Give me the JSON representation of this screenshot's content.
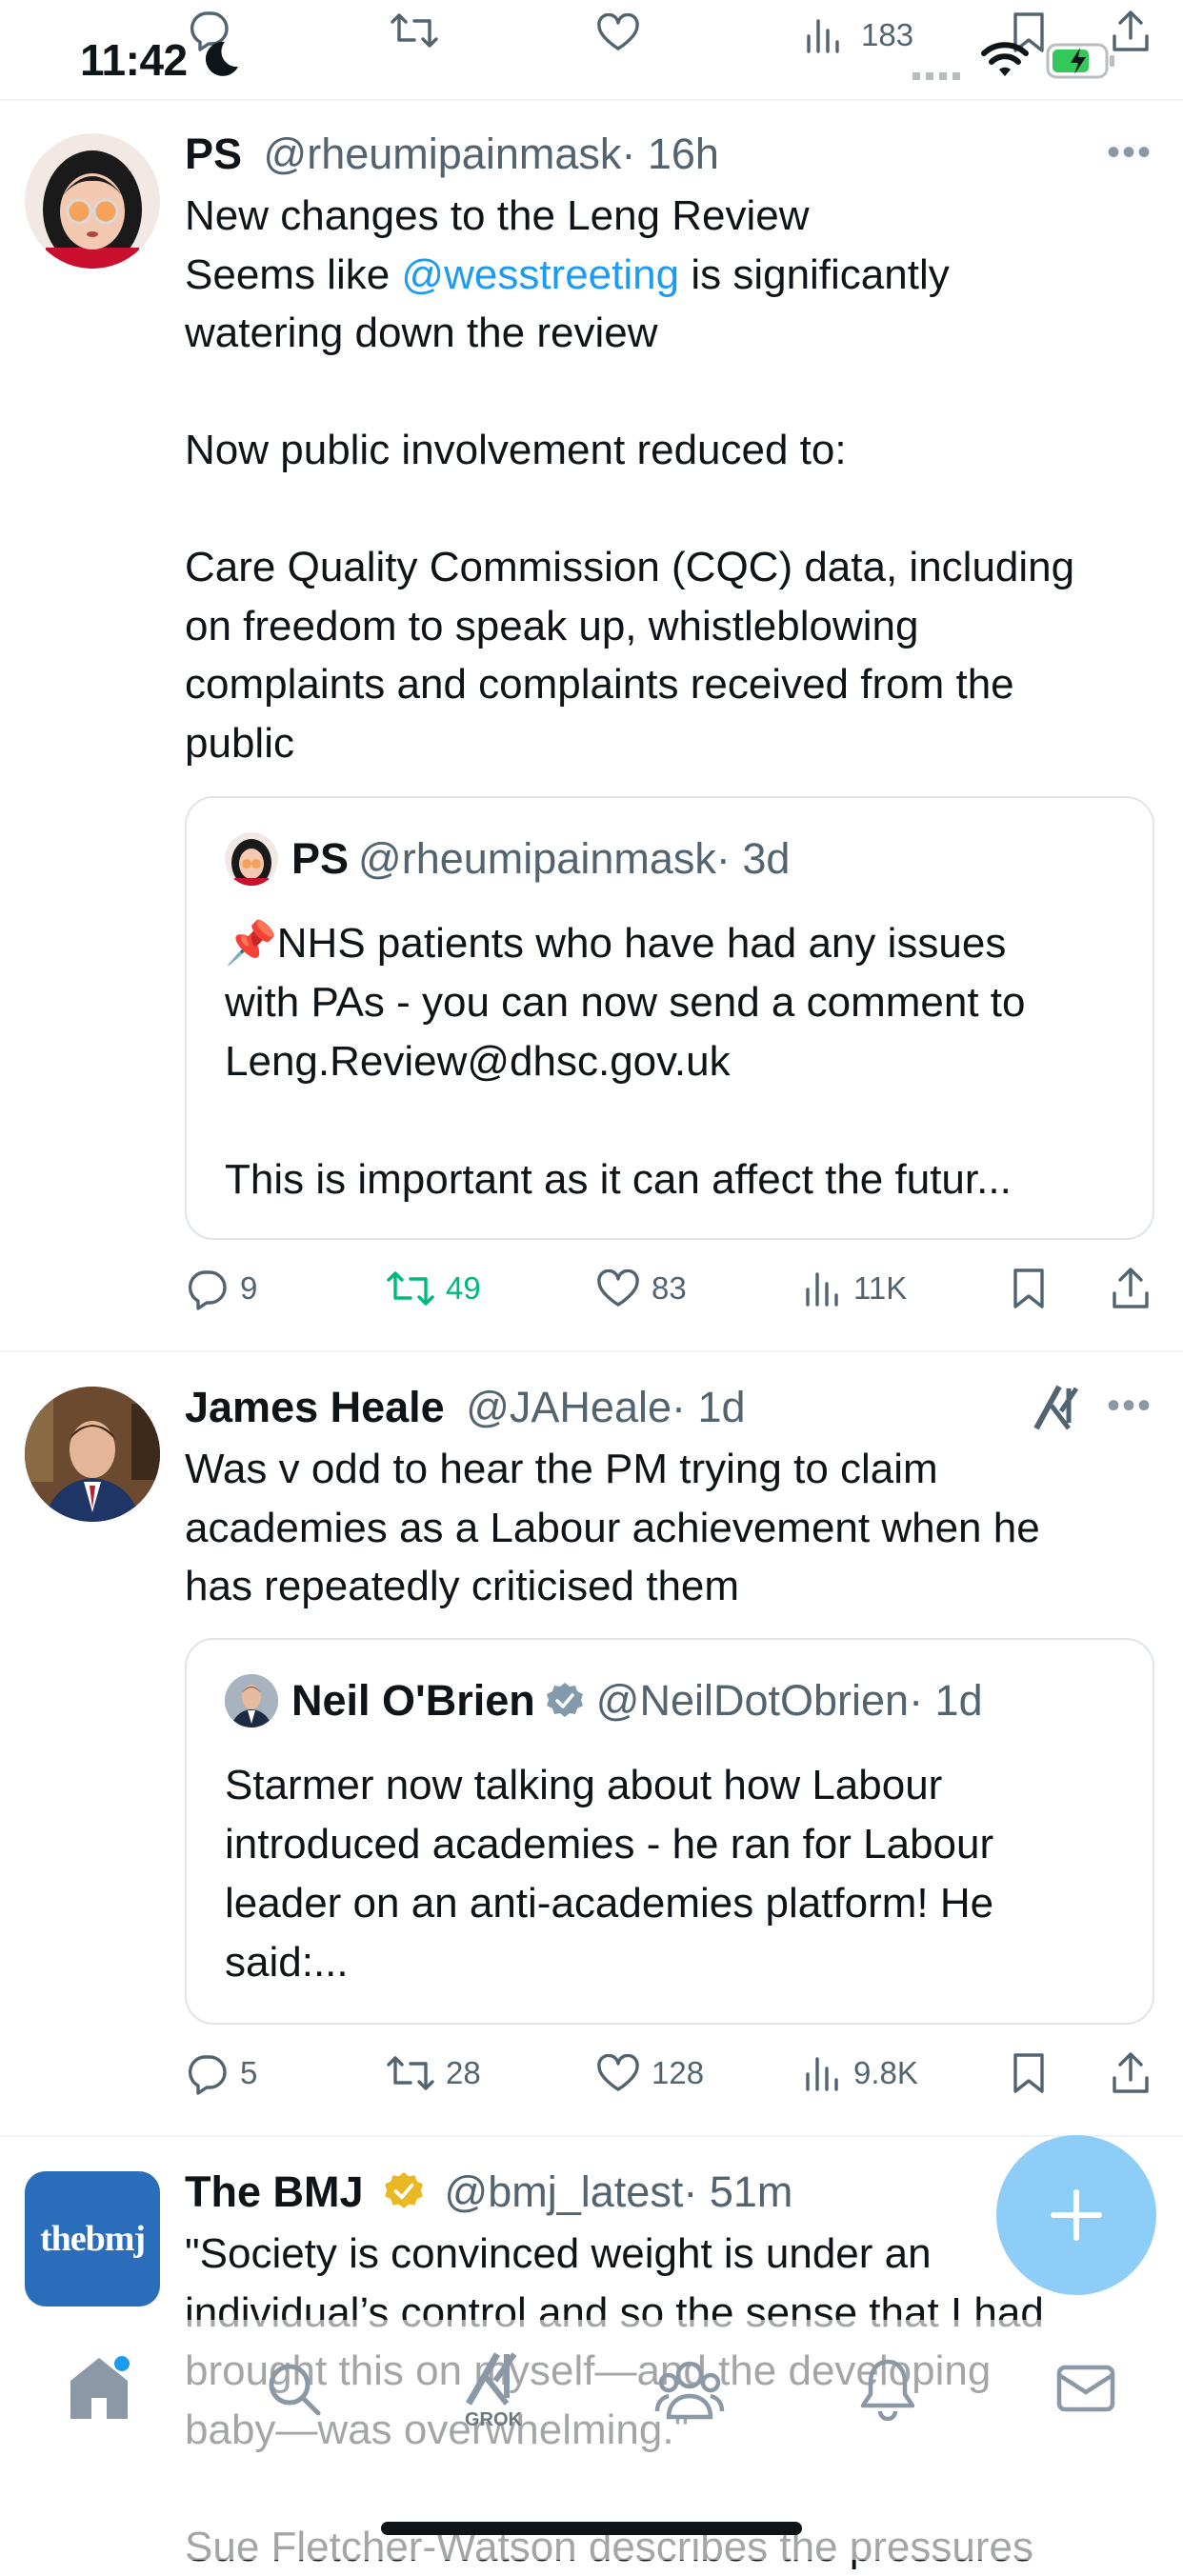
{
  "status_bar": {
    "time": "11:42",
    "views": "183"
  },
  "tweets": [
    {
      "name": "PS",
      "handle": "@rheumipainmask",
      "time": "· 16h",
      "text_parts": [
        "New changes to the Leng Review\nSeems like ",
        "@wesstreeting",
        " is significantly\nwatering down the review\n\nNow public involvement reduced to:\n\nCare Quality Commission (CQC) data, including\non freedom to speak up, whistleblowing\ncomplaints and complaints received from the\npublic"
      ],
      "quote": {
        "name": "PS",
        "handle": "@rheumipainmask",
        "time": "· 3d",
        "text": "📌NHS patients who have had any issues\nwith PAs - you can now send a comment to\nLeng.Review@dhsc.gov.uk\n\nThis is important as it can affect the futur..."
      },
      "stats": {
        "replies": "9",
        "reposts": "49",
        "likes": "83",
        "views": "11K"
      }
    },
    {
      "name": "James Heale",
      "handle": "@JAHeale",
      "time": "· 1d",
      "text": "Was v odd to hear the PM trying to claim\nacademies as a Labour achievement when he\nhas repeatedly criticised them",
      "quote": {
        "name": "Neil O'Brien",
        "handle": "@NeilDotObrien",
        "time": "· 1d",
        "text": "Starmer now talking about how Labour\nintroduced academies - he ran for Labour\nleader on an anti-academies platform! He\nsaid:..."
      },
      "stats": {
        "replies": "5",
        "reposts": "28",
        "likes": "128",
        "views": "9.8K"
      }
    },
    {
      "name": "The BMJ",
      "handle": "@bmj_latest",
      "time": "· 51m",
      "avatar_text": "thebmj",
      "text": "\"Society is convinced weight is under an\nindividual’s control and so the sense that I had\nbrought this on myself—and the developing\nbaby—was overwhelming.\"\n\nSue Fletcher-Watson describes the pressures"
    }
  ],
  "nav": {
    "grok_label": "GROK"
  },
  "colors": {
    "accent": "#1d9bf0",
    "repost_active": "#00ba7c",
    "muted": "#536471",
    "verified": "#e8b923",
    "fab": "#8ecdf7"
  },
  "icons": [
    "reply-icon",
    "repost-icon",
    "like-icon",
    "views-icon",
    "bookmark-icon",
    "share-icon",
    "more-icon",
    "grok-icon",
    "verified-icon",
    "home-icon",
    "search-icon",
    "communities-icon",
    "notifications-icon",
    "messages-icon",
    "compose-icon",
    "wifi-icon",
    "battery-icon",
    "moon-icon"
  ]
}
